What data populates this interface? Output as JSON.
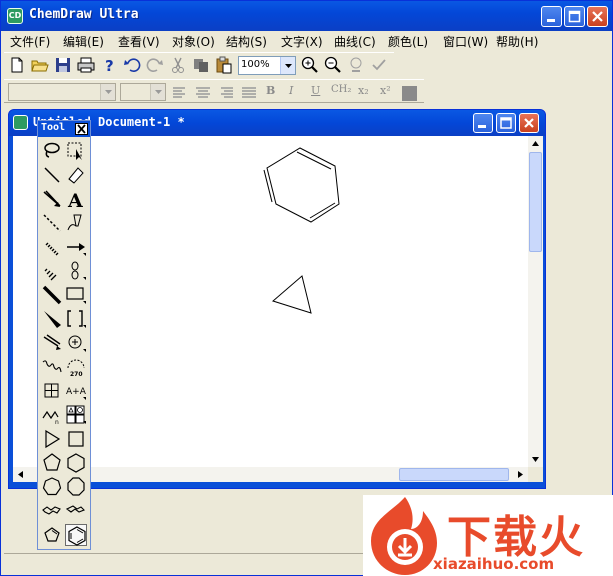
{
  "app": {
    "title": "ChemDraw Ultra",
    "icon_text": "CD"
  },
  "menu": [
    "文件(F)",
    "编辑(E)",
    "查看(V)",
    "对象(O)",
    "结构(S)",
    "文字(X)",
    "曲线(C)",
    "颜色(L)",
    "窗口(W)",
    "帮助(H)"
  ],
  "toolbar": {
    "zoom": "100%",
    "format_buttons": [
      "B",
      "I",
      "U",
      "CH₂",
      "x₂",
      "x²"
    ]
  },
  "document": {
    "title": "Untitled Document-1 *"
  },
  "tool_palette": {
    "title": "Tool",
    "tools": [
      "lasso-icon",
      "marquee-icon",
      "solid-bond-icon",
      "eraser-icon",
      "wedge-bond-icon",
      "text-icon",
      "dashed-bond-icon",
      "pen-icon",
      "hashed-bond-icon",
      "arrow-icon",
      "hashed-wedge-icon",
      "orbital-icon",
      "bold-bond-icon",
      "rectangle-icon",
      "bold-wedge-icon",
      "bracket-icon",
      "chain-icon",
      "charge-icon",
      "wavy-bond-icon",
      "orbital-angle-icon",
      "table-icon",
      "text-replace-icon",
      "acyclic-chain-icon",
      "template-icon",
      "cyclopropane-icon",
      "cyclobutane-icon",
      "cyclopentane-icon",
      "cyclohexane-icon",
      "cycloheptane-icon",
      "cyclooctane-icon",
      "chair1-icon",
      "chair2-icon",
      "cyclopentadiene-icon",
      "benzene-icon"
    ]
  },
  "watermark": {
    "text": "下载火",
    "sub": "xiazaihuo.com",
    "color": "#e84b2b"
  },
  "colors": {
    "title_blue": "#0a58e3",
    "close_red": "#c9401e",
    "chrome": "#ece9d8"
  }
}
